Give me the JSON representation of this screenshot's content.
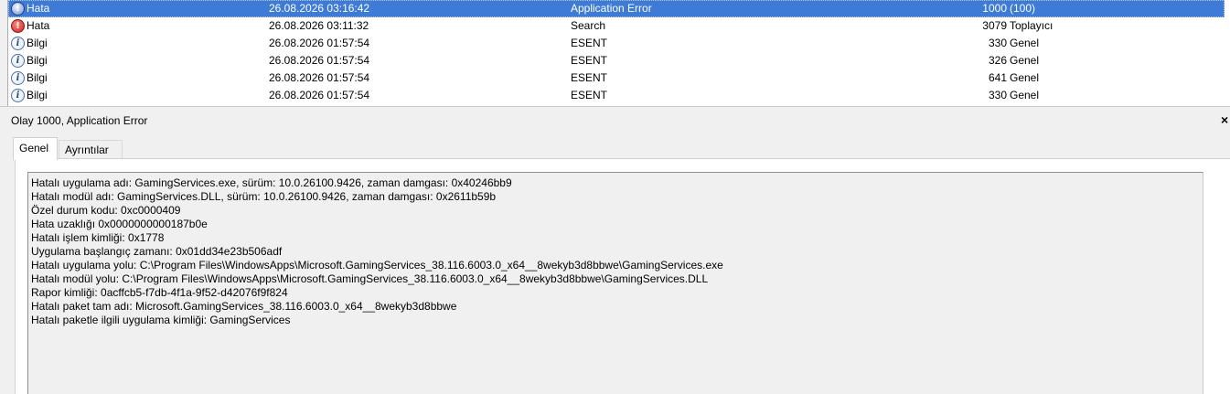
{
  "events": [
    {
      "level": "Hata",
      "icon": "error-icon",
      "date": "26.08.2026 03:16:42",
      "source": "Application Error",
      "id": "1000",
      "category": "(100)",
      "selected": true
    },
    {
      "level": "Hata",
      "icon": "error-icon",
      "date": "26.08.2026 03:11:32",
      "source": "Search",
      "id": "3079",
      "category": "Toplayıcı",
      "selected": false
    },
    {
      "level": "Bilgi",
      "icon": "info-icon",
      "date": "26.08.2026 01:57:54",
      "source": "ESENT",
      "id": "330",
      "category": "Genel",
      "selected": false
    },
    {
      "level": "Bilgi",
      "icon": "info-icon",
      "date": "26.08.2026 01:57:54",
      "source": "ESENT",
      "id": "326",
      "category": "Genel",
      "selected": false
    },
    {
      "level": "Bilgi",
      "icon": "info-icon",
      "date": "26.08.2026 01:57:54",
      "source": "ESENT",
      "id": "641",
      "category": "Genel",
      "selected": false
    },
    {
      "level": "Bilgi",
      "icon": "info-icon",
      "date": "26.08.2026 01:57:54",
      "source": "ESENT",
      "id": "330",
      "category": "Genel",
      "selected": false
    }
  ],
  "detail": {
    "title": "Olay 1000, Application Error",
    "close_glyph": "×"
  },
  "tabs": [
    {
      "label": "Genel",
      "active": true
    },
    {
      "label": "Ayrıntılar",
      "active": false
    }
  ],
  "message_lines": [
    "Hatalı uygulama adı: GamingServices.exe, sürüm: 10.0.26100.9426, zaman damgası: 0x40246bb9",
    "Hatalı modül adı: GamingServices.DLL, sürüm: 10.0.26100.9426, zaman damgası: 0x2611b59b",
    "Özel durum kodu: 0xc0000409",
    "Hata uzaklığı 0x0000000000187b0e",
    "Hatalı işlem kimliği: 0x1778",
    "Uygulama başlangıç zamanı: 0x01dd34e23b506adf",
    "Hatalı uygulama yolu: C:\\Program Files\\WindowsApps\\Microsoft.GamingServices_38.116.6003.0_x64__8wekyb3d8bbwe\\GamingServices.exe",
    "Hatalı modül yolu: C:\\Program Files\\WindowsApps\\Microsoft.GamingServices_38.116.6003.0_x64__8wekyb3d8bbwe\\GamingServices.DLL",
    "Rapor kimliği: 0acffcb5-f7db-4f1a-9f52-d42076f9f824",
    "Hatalı paket tam adı: Microsoft.GamingServices_38.116.6003.0_x64__8wekyb3d8bbwe",
    "Hatalı paketle ilgili uygulama kimliği: GamingServices"
  ],
  "colors": {
    "selection": "#3d7bd6",
    "error": "#c8201a",
    "info": "#1f4a8a"
  }
}
